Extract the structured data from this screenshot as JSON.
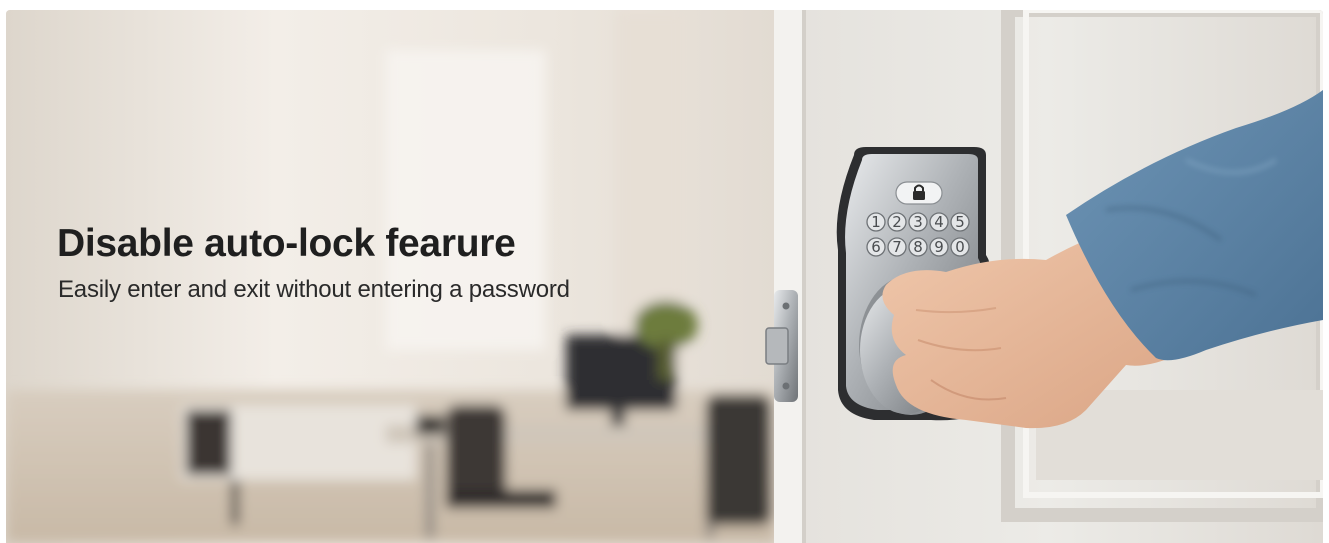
{
  "banner": {
    "headline": "Disable auto-lock fearure",
    "subline": "Easily enter and exit without entering a password"
  },
  "keypad": {
    "row1": [
      "1",
      "2",
      "3",
      "4",
      "5"
    ],
    "row2": [
      "6",
      "7",
      "8",
      "9",
      "0"
    ]
  },
  "colors": {
    "text_dark": "#1f1f1f",
    "wall": "#e9e2d9",
    "door": "#e6e3de",
    "sleeve": "#5f87a9",
    "metal": "#b9bcbf"
  },
  "icons": [
    "lock-icon",
    "keyhole-icon"
  ]
}
